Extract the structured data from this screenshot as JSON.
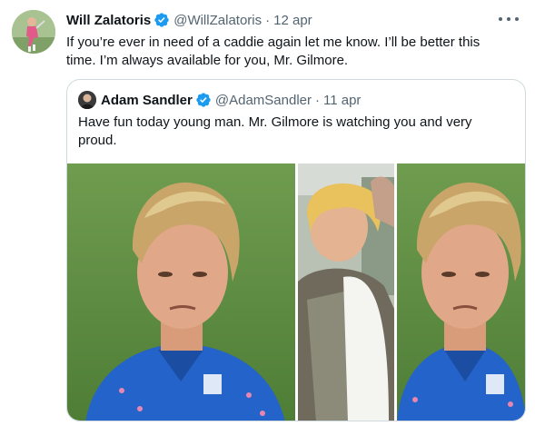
{
  "tweet": {
    "author_name": "Will Zalatoris",
    "author_handle": "@WillZalatoris",
    "separator": "·",
    "date": "12 apr",
    "verified_icon": "verified-badge-icon",
    "more_icon": "more-options-icon",
    "text_line1": "If you’re ever in need of a caddie again let me know. I’ll be better this",
    "text_line2": "time.  I’m always available for you, Mr. Gilmore."
  },
  "quoted": {
    "author_name": "Adam Sandler",
    "author_handle": "@AdamSandler",
    "separator": "·",
    "date": "11 apr",
    "text_line1": "Have fun today young man. Mr. Gilmore is watching you and very",
    "text_line2": "proud.",
    "media": [
      {
        "icon": "golfer-photo",
        "name": "photo-golfer-left"
      },
      {
        "icon": "movie-scene-photo",
        "name": "photo-movie-scene"
      },
      {
        "icon": "golfer-photo",
        "name": "photo-golfer-right"
      }
    ]
  },
  "colors": {
    "verified_blue": "#1d9bf0",
    "text_primary": "#0f1419",
    "text_secondary": "#536471",
    "border": "#cfd9de"
  }
}
